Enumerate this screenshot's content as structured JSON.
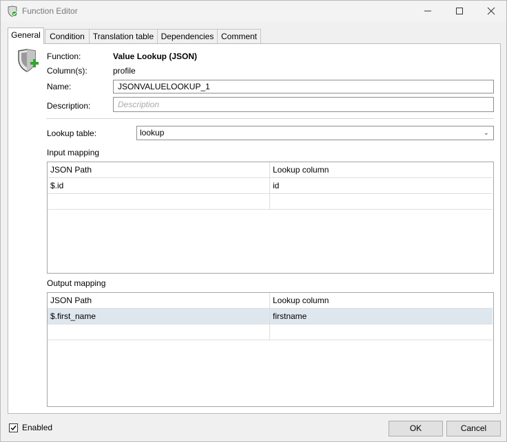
{
  "window": {
    "title": "Function Editor"
  },
  "tabs": [
    {
      "label": "General"
    },
    {
      "label": "Condition"
    },
    {
      "label": "Translation table"
    },
    {
      "label": "Dependencies"
    },
    {
      "label": "Comment"
    }
  ],
  "general": {
    "function_label": "Function:",
    "function_value": "Value Lookup (JSON)",
    "columns_label": "Column(s):",
    "columns_value": "profile",
    "name_label": "Name:",
    "name_value": "JSONVALUELOOKUP_1",
    "description_label": "Description:",
    "description_placeholder": "Description",
    "lookup_table_label": "Lookup table:",
    "lookup_table_value": "lookup"
  },
  "input_mapping": {
    "title": "Input mapping",
    "columns": [
      "JSON Path",
      "Lookup column"
    ],
    "rows": [
      [
        "$.id",
        "id"
      ],
      [
        "",
        ""
      ]
    ]
  },
  "output_mapping": {
    "title": "Output mapping",
    "columns": [
      "JSON Path",
      "Lookup column"
    ],
    "rows": [
      [
        "$.first_name",
        "firstname"
      ],
      [
        "",
        ""
      ]
    ]
  },
  "footer": {
    "enabled_label": "Enabled",
    "enabled_checked": true,
    "ok_label": "OK",
    "cancel_label": "Cancel"
  }
}
